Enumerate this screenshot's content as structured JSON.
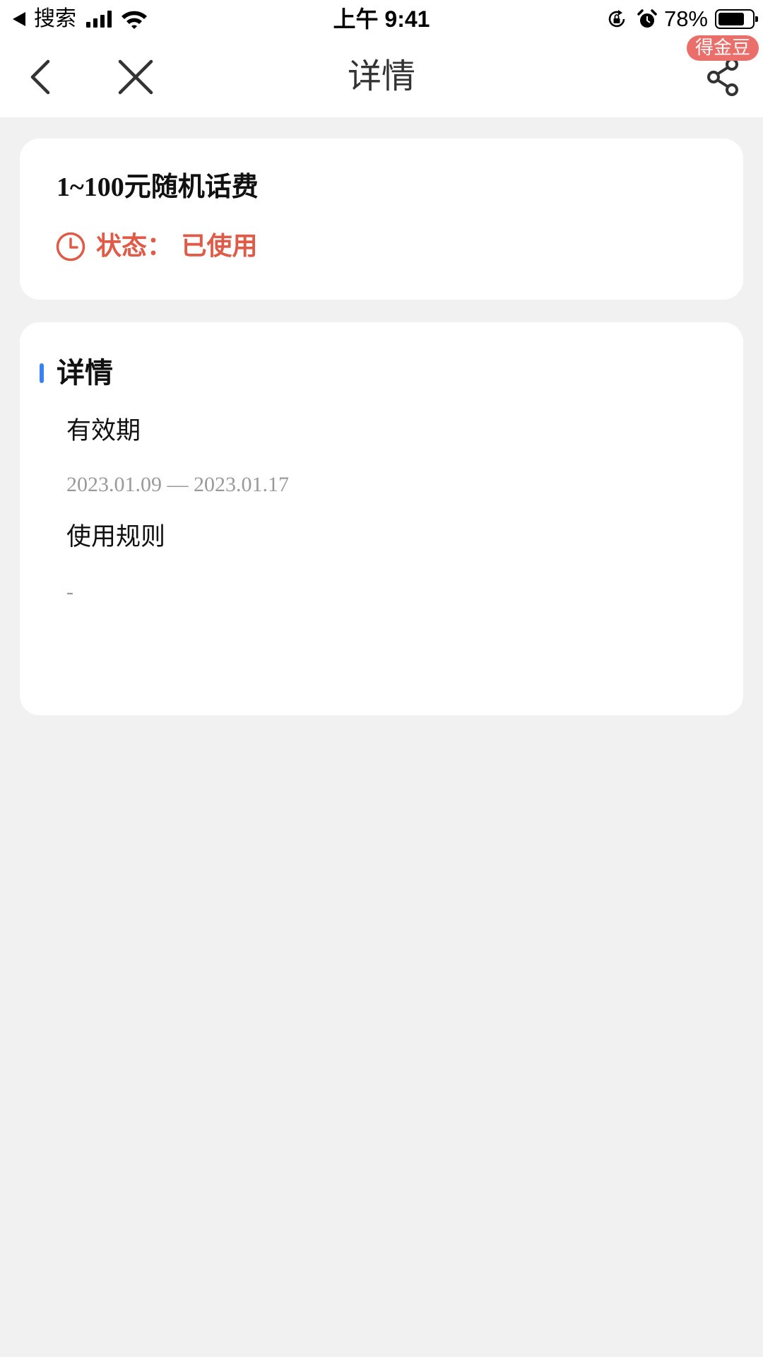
{
  "status_bar": {
    "back_app": "搜索",
    "time": "上午 9:41",
    "battery_pct": "78%",
    "battery_level": 0.78
  },
  "nav": {
    "title": "详情",
    "badge": "得金豆",
    "icons": [
      "chevron-left-icon",
      "close-icon",
      "share-icon"
    ]
  },
  "coupon": {
    "title": "1~100元随机话费",
    "status": "状态：  已使用",
    "status_color": "#e05a48"
  },
  "details": {
    "section_title": "详情",
    "accent_color": "#3b82f0",
    "validity_label": "有效期",
    "validity_value": "2023.01.09 — 2023.01.17",
    "rules_label": "使用规则",
    "rules_value": "-"
  }
}
